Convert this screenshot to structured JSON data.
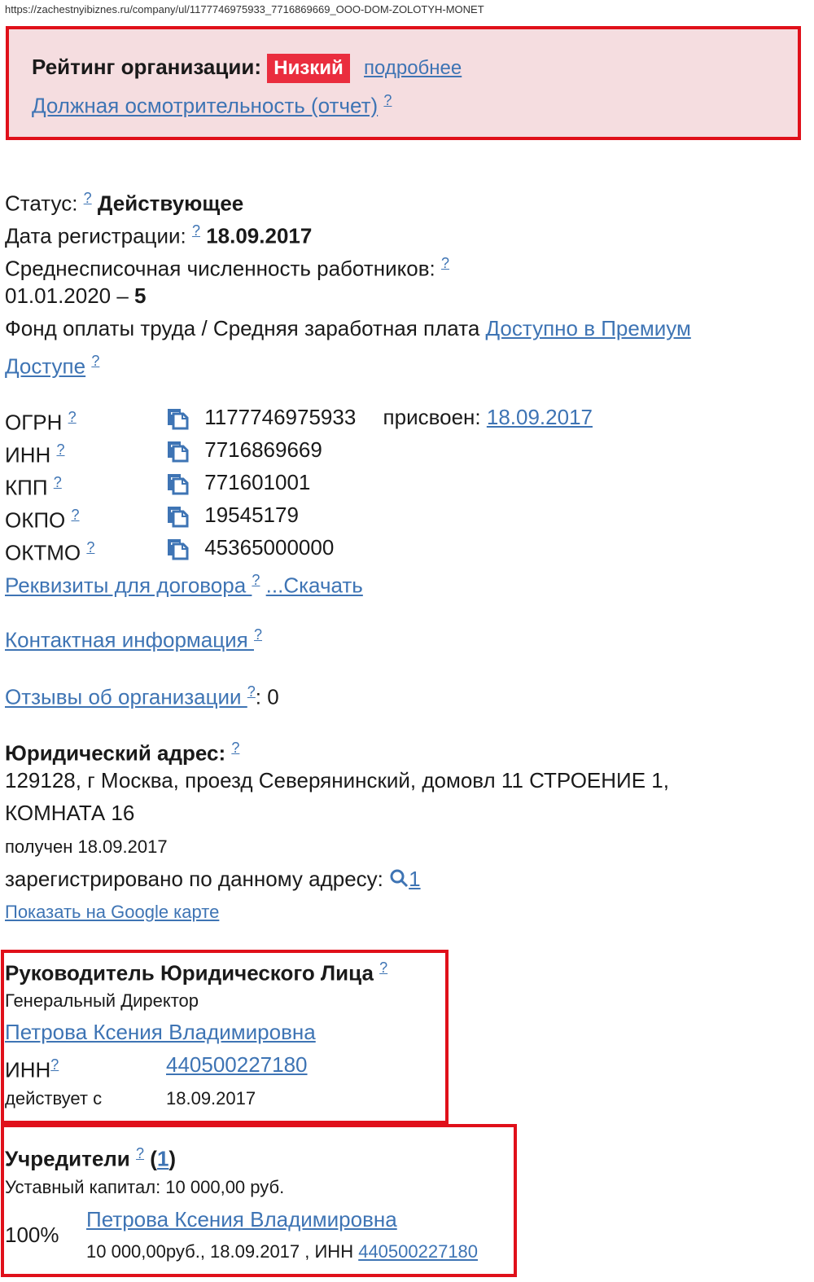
{
  "browser": {
    "url": "https://zachestnyibiznes.ru/company/ul/1177746975933_7716869669_OOO-DOM-ZOLOTYH-MONET"
  },
  "rating": {
    "label": "Рейтинг организации:",
    "badge": "Низкий",
    "more_link": "подробнее",
    "due_diligence_link": "Должная осмотрительность (отчет)",
    "help": "?"
  },
  "info": {
    "status_label": "Статус:",
    "status_value": "Действующее",
    "reg_date_label": "Дата регистрации:",
    "reg_date_value": "18.09.2017",
    "employees_label": "Среднесписочная численность работников:",
    "employees_date": "01.01.2020 –",
    "employees_value": "5",
    "payroll_label": "Фонд оплаты труда / Средняя заработная плата",
    "payroll_link_1": "Доступно в Премиум",
    "payroll_link_2": "Доступе",
    "help": "?"
  },
  "codes": [
    {
      "label": "ОГРН",
      "value": "1177746975933"
    },
    {
      "label": "ИНН",
      "value": "7716869669"
    },
    {
      "label": "КПП",
      "value": "771601001"
    },
    {
      "label": "ОКПО",
      "value": "19545179"
    },
    {
      "label": "ОКТМО",
      "value": "45365000000"
    }
  ],
  "ogrn_assigned_label": "присвоен:",
  "ogrn_assigned_date": "18.09.2017",
  "links": {
    "requisites": "Реквизиты для договора ",
    "download": "...Скачать",
    "contacts": "Контактная информация ",
    "reviews": "Отзывы об организации ",
    "reviews_count": ": 0"
  },
  "address": {
    "title": "Юридический адрес:",
    "line1": "129128, г Москва, проезд Северянинский, домовл 11 СТРОЕНИЕ 1,",
    "line2": "КОМНАТА 16",
    "received": "получен 18.09.2017",
    "registered_label": "зарегистрировано по данному адресу:",
    "registered_count": "1",
    "map_link": "Показать на Google карте"
  },
  "head": {
    "title": "Руководитель Юридического Лица",
    "position": "Генеральный Директор",
    "name": "Петрова Ксения Владимировна",
    "inn_label": "ИНН",
    "inn_value": "440500227180",
    "since_label": "действует с",
    "since_value": "18.09.2017"
  },
  "founders": {
    "title": "Учредители",
    "count": "1",
    "capital": "Уставный капитал: 10 000,00 руб.",
    "share": "100%",
    "name": "Петрова Ксения Владимировна",
    "details": "10 000,00руб., 18.09.2017 , ИНН",
    "inn": "440500227180"
  },
  "colors": {
    "link": "#3e74b4",
    "alert_border": "#e0101a",
    "alert_bg": "#f5dde0",
    "badge_bg": "#ea2d3e"
  }
}
